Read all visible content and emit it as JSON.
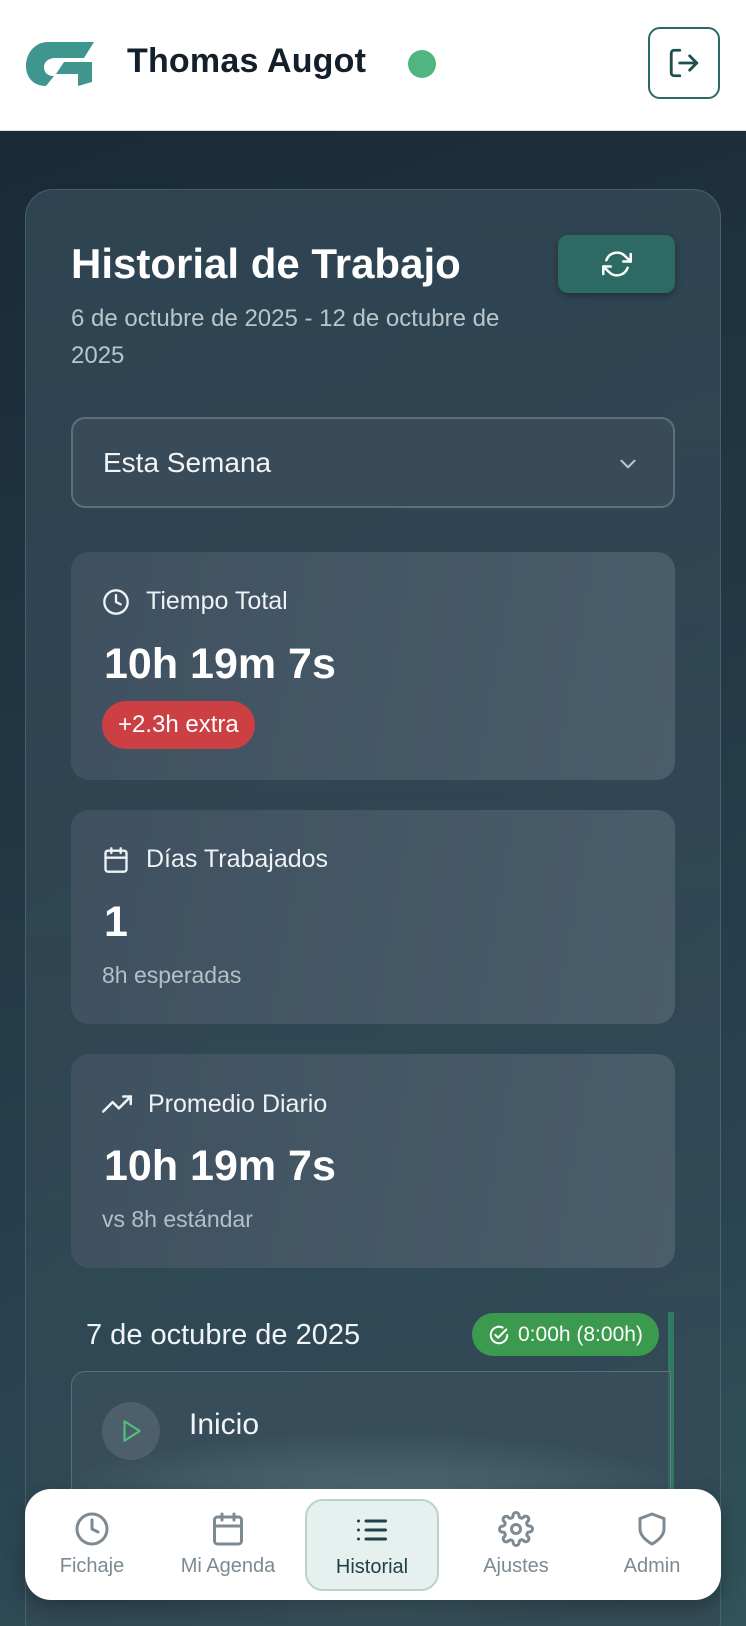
{
  "header": {
    "user_name": "Thomas Augot",
    "status_color": "#4fb67f",
    "logout_icon": "logout-icon",
    "logo_icon": "brand-logo"
  },
  "page": {
    "title": "Historial de Trabajo",
    "date_range": "6 de octubre de 2025 - 12 de octubre de 2025",
    "refresh_icon": "refresh-icon"
  },
  "period_select": {
    "value": "Esta Semana"
  },
  "stats": {
    "total": {
      "icon": "clock-icon",
      "label": "Tiempo Total",
      "value": "10h 19m 7s",
      "badge": "+2.3h extra"
    },
    "days": {
      "icon": "calendar-icon",
      "label": "Días Trabajados",
      "value": "1",
      "sub": "8h esperadas"
    },
    "average": {
      "icon": "trending-up-icon",
      "label": "Promedio Diario",
      "value": "10h 19m 7s",
      "sub": "vs 8h estándar"
    }
  },
  "day": {
    "date": "7 de octubre de 2025",
    "badge": "0:00h (8:00h)",
    "entries": [
      {
        "icon": "play-icon",
        "label": "Inicio"
      }
    ]
  },
  "nav": {
    "items": [
      {
        "label": "Fichaje",
        "icon": "clock-icon"
      },
      {
        "label": "Mi Agenda",
        "icon": "calendar-icon"
      },
      {
        "label": "Historial",
        "icon": "list-icon",
        "active": true
      },
      {
        "label": "Ajustes",
        "icon": "gear-icon"
      },
      {
        "label": "Admin",
        "icon": "shield-icon"
      }
    ]
  },
  "colors": {
    "accent": "#2d6a64",
    "danger": "#cc3f43",
    "success": "#3c9a4e"
  }
}
